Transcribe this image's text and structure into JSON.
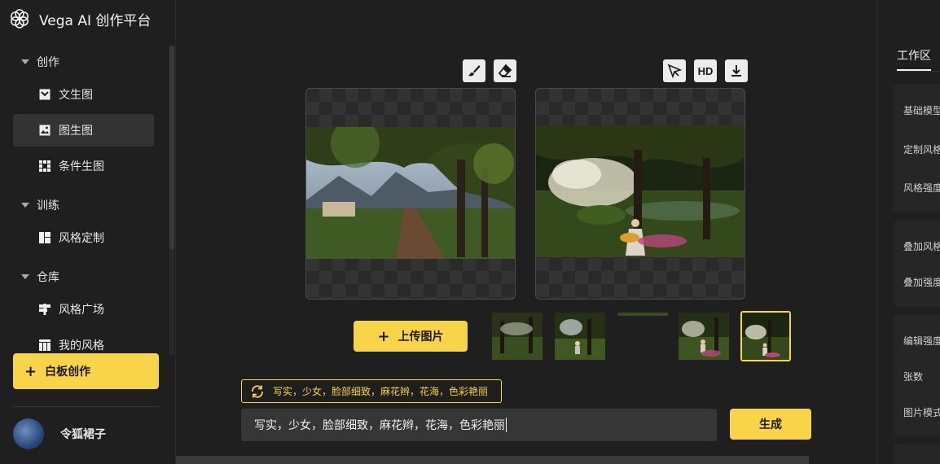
{
  "app": {
    "title": "Vega AI 创作平台"
  },
  "sidebar": {
    "sections": [
      {
        "label": "创作",
        "items": [
          {
            "label": "文生图"
          },
          {
            "label": "图生图"
          },
          {
            "label": "条件生图"
          }
        ]
      },
      {
        "label": "训练",
        "items": [
          {
            "label": "风格定制"
          }
        ]
      },
      {
        "label": "仓库",
        "items": [
          {
            "label": "风格广场"
          },
          {
            "label": "我的风格"
          }
        ]
      }
    ],
    "active_item": "图生图",
    "board_button": "白板创作",
    "user_name": "令狐裙子"
  },
  "toolbar_left": {
    "icons": [
      "brush-icon",
      "eraser-icon"
    ]
  },
  "toolbar_right": {
    "icons": [
      "cursor-icon",
      "download-icon"
    ],
    "hd_label": "HD"
  },
  "upload_button": "上传图片",
  "thumbnails": {
    "count": 5,
    "selected_index": 4
  },
  "prompt": {
    "suggestion": "写实，少女，脸部细致，麻花辫，花海，色彩艳丽",
    "value": "写实，少女，脸部细致，麻花辫，花海，色彩艳丽"
  },
  "generate_button": "生成",
  "right_panel": {
    "tab": "工作区",
    "labels": [
      "基础模型",
      "定制风格",
      "风格强度",
      "叠加风格",
      "叠加强度",
      "编辑强度",
      "张数",
      "图片模式"
    ]
  },
  "colors": {
    "accent": "#f7d448",
    "background": "#1f1f1f"
  }
}
